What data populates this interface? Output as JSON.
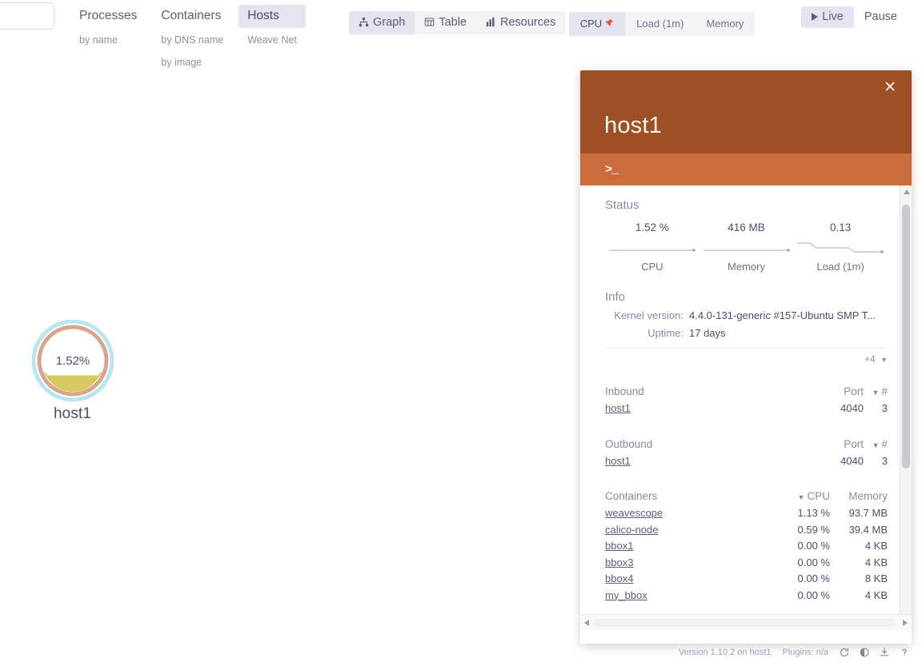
{
  "search": {
    "placeholder": "",
    "value": ""
  },
  "topology": {
    "columns": [
      {
        "main": "Processes",
        "main_name": "processes",
        "active": false,
        "subs": [
          "by name"
        ]
      },
      {
        "main": "Containers",
        "main_name": "containers",
        "active": false,
        "subs": [
          "by DNS name",
          "by image"
        ]
      },
      {
        "main": "Hosts",
        "main_name": "hosts",
        "active": true,
        "subs": [
          "Weave Net"
        ]
      }
    ]
  },
  "view_tabs": [
    {
      "label": "Graph",
      "icon": "graph-icon",
      "active": true
    },
    {
      "label": "Table",
      "icon": "table-icon",
      "active": false
    },
    {
      "label": "Resources",
      "icon": "resources-icon",
      "active": false
    }
  ],
  "metric_tabs": [
    {
      "label": "CPU",
      "active": true,
      "pinned": true,
      "pin_icon": "pin-icon"
    },
    {
      "label": "Load (1m)",
      "active": false,
      "pinned": false
    },
    {
      "label": "Memory",
      "active": false,
      "pinned": false
    }
  ],
  "time_controls": [
    {
      "label": "Live",
      "icon": "play-icon",
      "active": true
    },
    {
      "label": "Pause",
      "icon": "",
      "active": false
    }
  ],
  "graph": {
    "nodes": [
      {
        "label": "host1",
        "metric_text": "1.52%",
        "metric_value": 1.52,
        "halo_color": "#b8e6f0",
        "ring_color": "#d9a68c",
        "fill_color": "#cfc44f"
      }
    ]
  },
  "details": {
    "title": "host1",
    "close_label": "✕",
    "header_color": "#9d4f25",
    "toolbar_color": "#cc6c3c",
    "terminal_glyph": ">_",
    "status": {
      "heading": "Status",
      "metrics": [
        {
          "value": "1.52 %",
          "label": "CPU"
        },
        {
          "value": "416 MB",
          "label": "Memory"
        },
        {
          "value": "0.13",
          "label": "Load (1m)"
        }
      ]
    },
    "info": {
      "heading": "Info",
      "rows": [
        {
          "key": "Kernel version:",
          "value": "4.4.0-131-generic #157-Ubuntu SMP T..."
        },
        {
          "key": "Uptime:",
          "value": "17 days"
        }
      ],
      "more_label": "+4"
    },
    "inbound": {
      "heading": "Inbound",
      "col_port": "Port",
      "col_count": "#",
      "rows": [
        {
          "name": "host1",
          "port": "4040",
          "count": "3"
        }
      ]
    },
    "outbound": {
      "heading": "Outbound",
      "col_port": "Port",
      "col_count": "#",
      "rows": [
        {
          "name": "host1",
          "port": "4040",
          "count": "3"
        }
      ]
    },
    "containers": {
      "heading": "Containers",
      "col_cpu": "CPU",
      "col_memory": "Memory",
      "rows": [
        {
          "name": "weavescope",
          "cpu": "1.13 %",
          "memory": "93.7 MB"
        },
        {
          "name": "calico-node",
          "cpu": "0.59 %",
          "memory": "39.4 MB"
        },
        {
          "name": "bbox1",
          "cpu": "0.00 %",
          "memory": "4 KB"
        },
        {
          "name": "bbox3",
          "cpu": "0.00 %",
          "memory": "4 KB"
        },
        {
          "name": "bbox4",
          "cpu": "0.00 %",
          "memory": "8 KB"
        },
        {
          "name": "my_bbox",
          "cpu": "0.00 %",
          "memory": "4 KB"
        }
      ]
    }
  },
  "footer": {
    "version": "Version 1.10.2 on host1",
    "plugins": "Plugins: n/a",
    "icons": [
      "refresh-icon",
      "contrast-icon",
      "download-icon",
      "help-icon"
    ]
  }
}
